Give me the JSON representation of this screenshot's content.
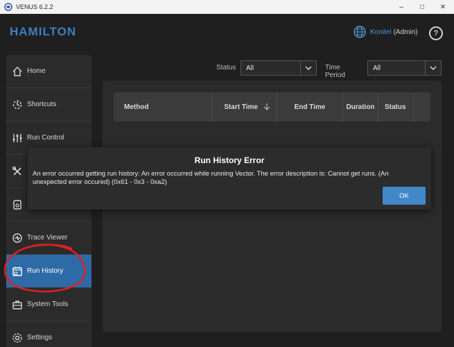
{
  "window": {
    "title": "VENUS 6.2.2"
  },
  "header": {
    "logo": "HAMILTON",
    "user_name": "Konitel",
    "user_role": "(Admin)",
    "help": "?"
  },
  "sidebar": {
    "items": [
      {
        "label": "Home",
        "icon": "home-icon"
      },
      {
        "label": "Shortcuts",
        "icon": "shortcuts-icon"
      },
      {
        "label": "Run Control",
        "icon": "sliders-icon"
      },
      {
        "label": "",
        "icon": "tools-icon"
      },
      {
        "label": "",
        "icon": "document-icon"
      },
      {
        "label": "Trace Viewer",
        "icon": "trace-icon"
      },
      {
        "label": "Run History",
        "icon": "calendar-clock-icon",
        "active": true
      },
      {
        "label": "System Tools",
        "icon": "toolbox-icon"
      },
      {
        "label": "Settings",
        "icon": "settings-icon"
      }
    ]
  },
  "filters": {
    "status_label": "Status",
    "status_value": "All",
    "period_label": "Time Period",
    "period_value": "All"
  },
  "table": {
    "columns": [
      "Method",
      "Start Time",
      "End Time",
      "Duration",
      "Status"
    ]
  },
  "dialog": {
    "title": "Run History Error",
    "message": "An error occurred getting run history: An error occurred while running Vector. The error description is: Cannot get runs. (An unexpected error occured) (0x61 - 0x3 - 0xa2)",
    "ok_label": "OK"
  },
  "colors": {
    "accent": "#2e6aa6",
    "brand": "#3d7fc0",
    "annotation": "#e0201f"
  }
}
